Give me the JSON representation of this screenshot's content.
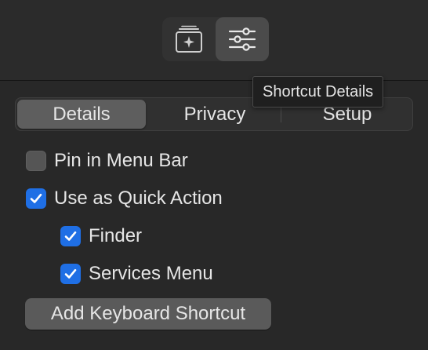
{
  "toolbar": {
    "library_icon": "sparkle-stack-icon",
    "details_icon": "sliders-icon"
  },
  "tooltip": {
    "text": "Shortcut Details"
  },
  "tabs": [
    {
      "label": "Details",
      "selected": true
    },
    {
      "label": "Privacy",
      "selected": false
    },
    {
      "label": "Setup",
      "selected": false
    }
  ],
  "options": {
    "pin_menu_bar": {
      "label": "Pin in Menu Bar",
      "checked": false
    },
    "quick_action": {
      "label": "Use as Quick Action",
      "checked": true
    },
    "finder": {
      "label": "Finder",
      "checked": true
    },
    "services_menu": {
      "label": "Services Menu",
      "checked": true
    }
  },
  "add_shortcut_button": {
    "label": "Add Keyboard Shortcut"
  },
  "colors": {
    "accent": "#1f6fe5",
    "background": "#282828"
  }
}
